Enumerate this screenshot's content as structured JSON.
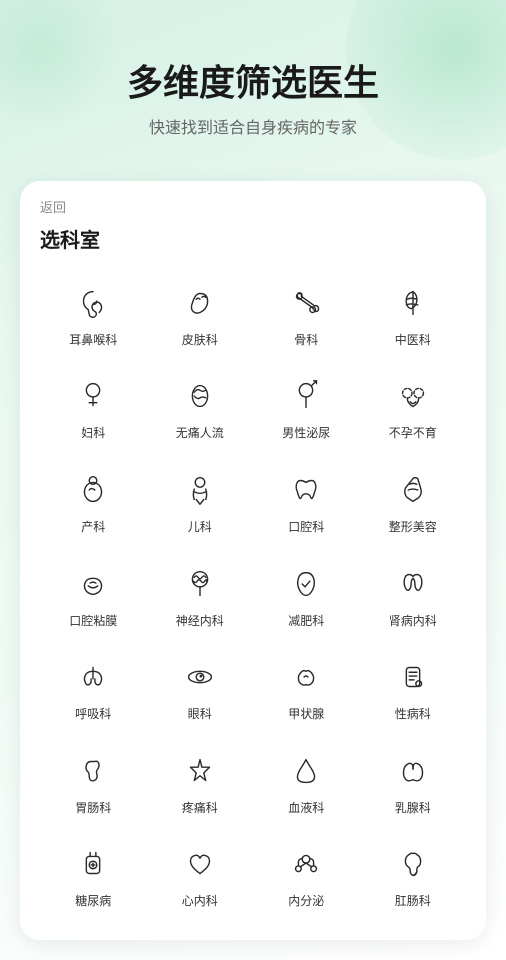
{
  "hero": {
    "title": "多维度筛选医生",
    "subtitle": "快速找到适合自身疾病的专家"
  },
  "card": {
    "back_label": "返回",
    "title": "选科室",
    "items": [
      {
        "label": "耳鼻喉科",
        "icon": "ear"
      },
      {
        "label": "皮肤科",
        "icon": "skin"
      },
      {
        "label": "骨科",
        "icon": "bone"
      },
      {
        "label": "中医科",
        "icon": "tcm"
      },
      {
        "label": "妇科",
        "icon": "gynecology"
      },
      {
        "label": "无痛人流",
        "icon": "painless"
      },
      {
        "label": "男性泌尿",
        "icon": "male-urology"
      },
      {
        "label": "不孕不育",
        "icon": "infertility"
      },
      {
        "label": "产科",
        "icon": "obstetrics"
      },
      {
        "label": "儿科",
        "icon": "pediatrics"
      },
      {
        "label": "口腔科",
        "icon": "dental"
      },
      {
        "label": "整形美容",
        "icon": "cosmetic"
      },
      {
        "label": "口腔粘膜",
        "icon": "oral-mucosa"
      },
      {
        "label": "神经内科",
        "icon": "neurology"
      },
      {
        "label": "减肥科",
        "icon": "weight-loss"
      },
      {
        "label": "肾病内科",
        "icon": "nephrology"
      },
      {
        "label": "呼吸科",
        "icon": "respiratory"
      },
      {
        "label": "眼科",
        "icon": "ophthalmology"
      },
      {
        "label": "甲状腺",
        "icon": "thyroid"
      },
      {
        "label": "性病科",
        "icon": "std"
      },
      {
        "label": "胃肠科",
        "icon": "gastro"
      },
      {
        "label": "疼痛科",
        "icon": "pain"
      },
      {
        "label": "血液科",
        "icon": "blood"
      },
      {
        "label": "乳腺科",
        "icon": "breast"
      },
      {
        "label": "糖尿病",
        "icon": "diabetes"
      },
      {
        "label": "心内科",
        "icon": "cardiology"
      },
      {
        "label": "内分泌",
        "icon": "endocrine"
      },
      {
        "label": "肛肠科",
        "icon": "colorectal"
      }
    ]
  }
}
